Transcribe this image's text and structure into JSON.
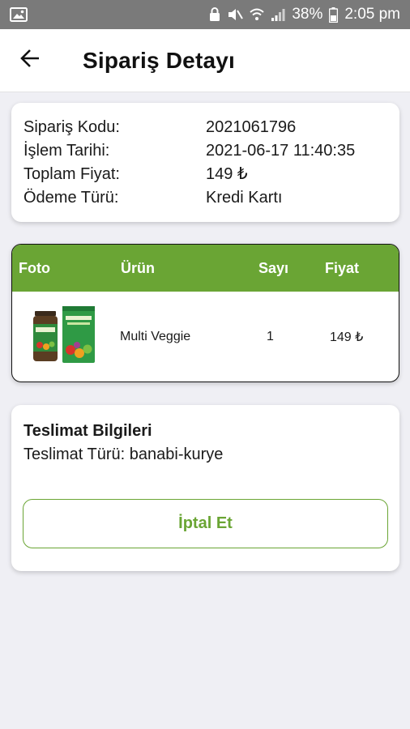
{
  "status_bar": {
    "battery": "38%",
    "time": "2:05 pm"
  },
  "header": {
    "title": "Sipariş Detayı"
  },
  "order_info": {
    "rows": [
      {
        "label": "Sipariş Kodu:",
        "value": "2021061796"
      },
      {
        "label": "İşlem Tarihi:",
        "value": "2021-06-17 11:40:35"
      },
      {
        "label": "Toplam Fiyat:",
        "value": "149 ₺"
      },
      {
        "label": "Ödeme Türü:",
        "value": "Kredi Kartı"
      }
    ]
  },
  "items_table": {
    "columns": [
      "Foto",
      "Ürün",
      "Sayı",
      "Fiyat"
    ],
    "rows": [
      {
        "name": "Multi Veggie",
        "count": "1",
        "price": "149 ₺"
      }
    ]
  },
  "delivery": {
    "title": "Teslimat Bilgileri",
    "type_line": "Teslimat Türü: banabi-kurye",
    "cancel_label": "İptal Et"
  },
  "colors": {
    "accent": "#6aa534",
    "status_bar": "#7a7a7a",
    "background": "#efeff4"
  }
}
